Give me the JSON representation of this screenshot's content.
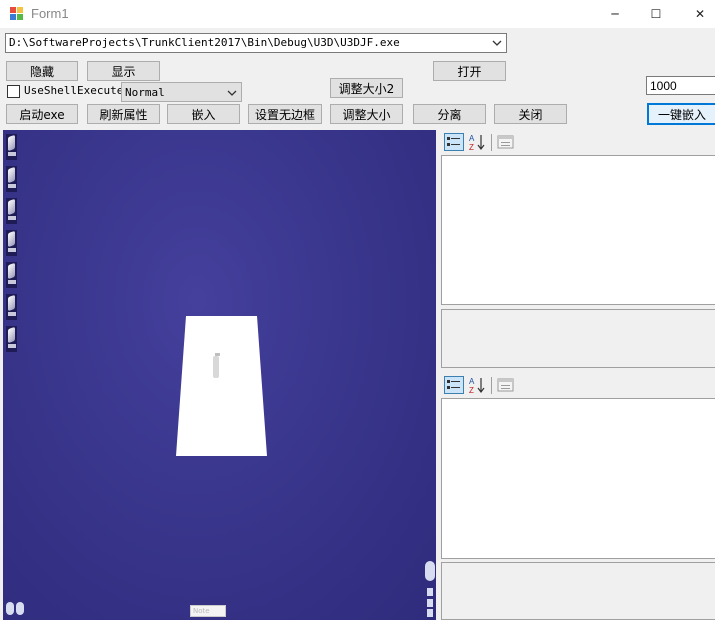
{
  "window": {
    "title": "Form1",
    "controls": {
      "minimize": "─",
      "maximize": "☐",
      "close": "✕"
    }
  },
  "path_combo": {
    "value": "D:\\SoftwareProjects\\TrunkClient2017\\Bin\\Debug\\U3D\\U3DJF.exe"
  },
  "buttons": {
    "hide": "隐藏",
    "show": "显示",
    "open": "打开",
    "resize2": "调整大小2",
    "start_exe": "启动exe",
    "refresh_props": "刷新属性",
    "embed": "嵌入",
    "set_borderless": "设置无边框",
    "resize": "调整大小",
    "detach": "分离",
    "close": "关闭",
    "one_click_embed": "一键嵌入"
  },
  "use_shell_execute": {
    "label": "UseShellExecute",
    "checked": false
  },
  "window_style_select": {
    "value": "Normal"
  },
  "interval_input": {
    "value": "1000"
  },
  "viewport": {
    "scale_label": "Note"
  },
  "property_grid_top": {
    "icons": [
      "categorized-icon",
      "alphabetical-icon",
      "property-pages-icon"
    ]
  },
  "property_grid_bottom": {
    "icons": [
      "categorized-icon",
      "alphabetical-icon",
      "property-pages-icon"
    ]
  },
  "colors": {
    "viewport_bg": "#37348a",
    "primary_border": "#0078d7",
    "button_bg": "#e1e1e1"
  }
}
